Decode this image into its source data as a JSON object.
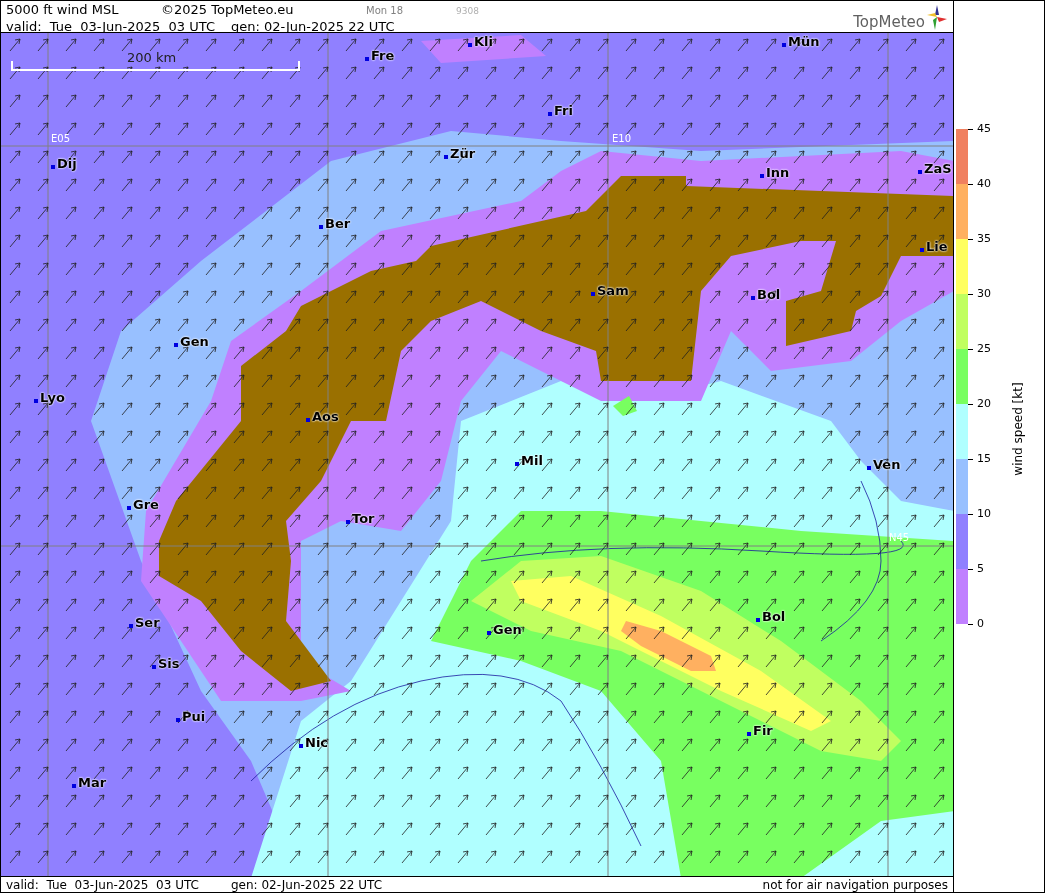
{
  "header": {
    "title": "5000 ft wind MSL",
    "copyright": "©2025 TopMeteo.eu",
    "run_label": "Mon 18",
    "code": "9308",
    "valid": "valid:  Tue  03-Jun-2025  03 UTC",
    "generated": "gen: 02-Jun-2025 22 UTC",
    "logo": "TopMeteo"
  },
  "map": {
    "scale_label": "200 km",
    "grid_labels": [
      "E05",
      "E10",
      "N45"
    ],
    "places": [
      "Kli",
      "Mün",
      "Fre",
      "Fri",
      "Dij",
      "Zür",
      "Inn",
      "ZaS",
      "Ber",
      "Lie",
      "Sam",
      "Bol",
      "Gen",
      "Lyo",
      "Aos",
      "Mil",
      "Ven",
      "Gre",
      "Tor",
      "Ser",
      "Gen",
      "Bol",
      "Sis",
      "Pui",
      "Nic",
      "Fir",
      "Mar"
    ]
  },
  "legend": {
    "title": "wind speed [kt]",
    "ticks": [
      "45",
      "40",
      "35",
      "30",
      "25",
      "20",
      "15",
      "10",
      "5",
      "0"
    ],
    "bands": [
      {
        "color": "#f08060"
      },
      {
        "color": "#ffb060"
      },
      {
        "color": "#ffff60"
      },
      {
        "color": "#c0ff60"
      },
      {
        "color": "#78ff60"
      },
      {
        "color": "#b0ffff"
      },
      {
        "color": "#98c0ff"
      },
      {
        "color": "#9080ff"
      },
      {
        "color": "#c080ff"
      }
    ]
  },
  "footer": {
    "valid": "valid:  Tue  03-Jun-2025  03 UTC",
    "generated": "gen: 02-Jun-2025 22 UTC",
    "disclaimer": "not for air navigation purposes"
  }
}
